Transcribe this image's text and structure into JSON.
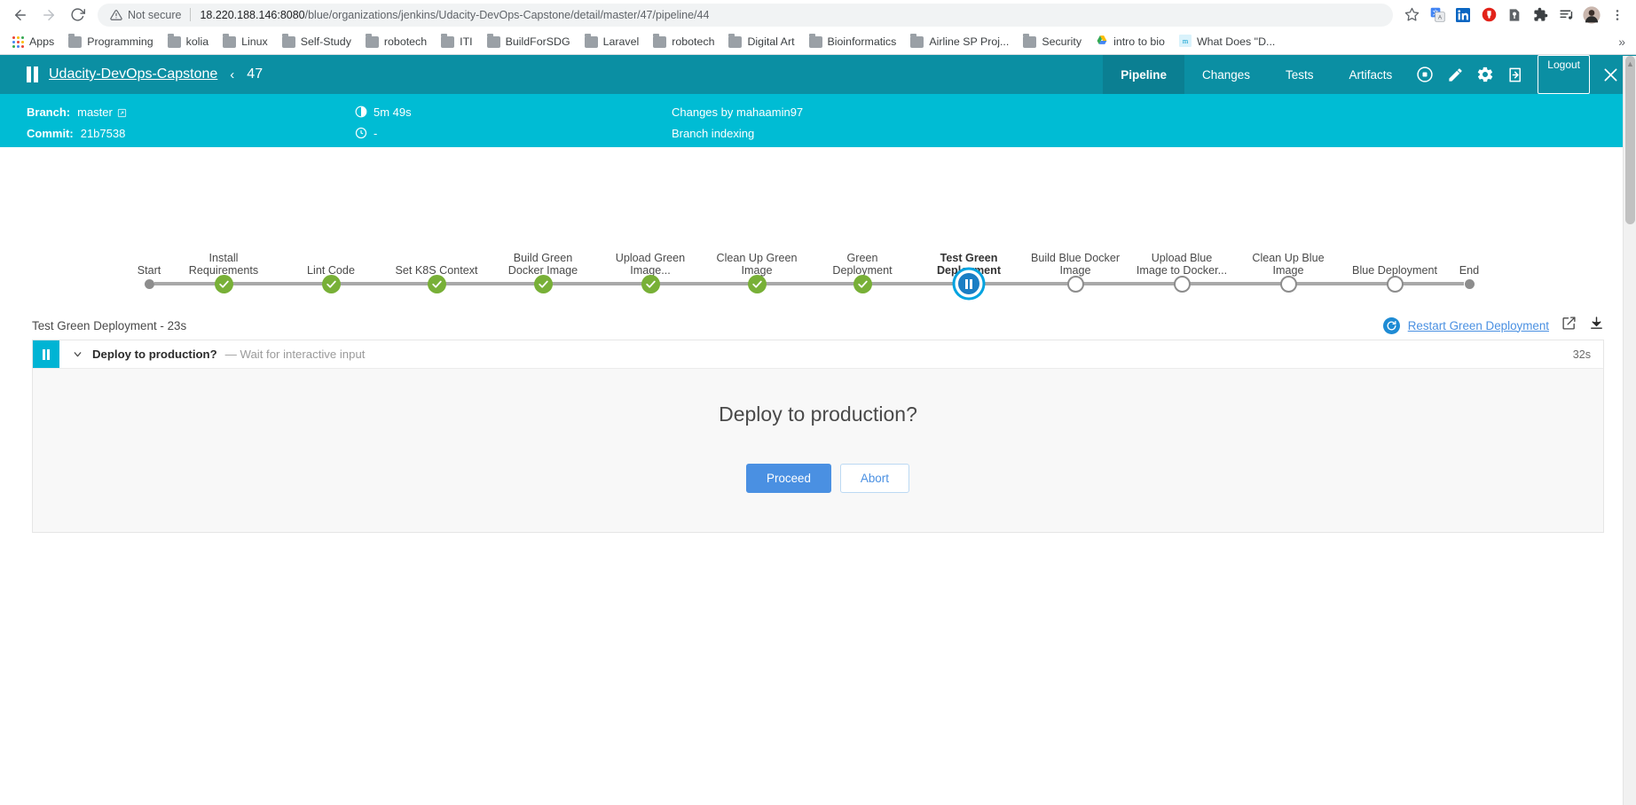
{
  "browser": {
    "back_icon": "back-arrow-icon",
    "forward_icon": "forward-arrow-icon",
    "reload_icon": "reload-icon",
    "security_label": "Not secure",
    "url_host": "18.220.188.146:8080",
    "url_path": "/blue/organizations/jenkins/Udacity-DevOps-Capstone/detail/master/47/pipeline/44",
    "toolbar_icons": [
      "bookmark-star-icon",
      "google-translate-icon",
      "linkedin-icon",
      "adblock-icon",
      "lastpass-icon",
      "extensions-puzzle-icon",
      "playlist-icon",
      "profile-avatar",
      "chrome-menu-icon"
    ],
    "bookmarks": [
      {
        "label": "Apps",
        "icon": "apps-grid-icon"
      },
      {
        "label": "Programming",
        "icon": "folder-icon"
      },
      {
        "label": "kolia",
        "icon": "folder-icon"
      },
      {
        "label": "Linux",
        "icon": "folder-icon"
      },
      {
        "label": "Self-Study",
        "icon": "folder-icon"
      },
      {
        "label": "robotech",
        "icon": "folder-icon"
      },
      {
        "label": "ITI",
        "icon": "folder-icon"
      },
      {
        "label": "BuildForSDG",
        "icon": "folder-icon"
      },
      {
        "label": "Laravel",
        "icon": "folder-icon"
      },
      {
        "label": "robotech",
        "icon": "folder-icon"
      },
      {
        "label": "Digital Art",
        "icon": "folder-icon"
      },
      {
        "label": "Bioinformatics",
        "icon": "folder-icon"
      },
      {
        "label": "Airline SP Proj...",
        "icon": "folder-icon"
      },
      {
        "label": "Security",
        "icon": "folder-icon"
      },
      {
        "label": "intro to bio",
        "icon": "drive-icon"
      },
      {
        "label": "What Does \"D...",
        "icon": "medium-icon"
      }
    ],
    "bookmarks_overflow": "»"
  },
  "app": {
    "status_icon": "pause-icon",
    "project_name": "Udacity-DevOps-Capstone",
    "separator": "‹",
    "run_number": "47",
    "nav_tabs": [
      {
        "label": "Pipeline",
        "active": true
      },
      {
        "label": "Changes",
        "active": false
      },
      {
        "label": "Tests",
        "active": false
      },
      {
        "label": "Artifacts",
        "active": false
      }
    ],
    "action_icons": [
      "stop-circle-icon",
      "edit-pencil-icon",
      "gear-icon",
      "logout-arrow-icon"
    ],
    "logout_label": "Logout",
    "close_icon": "close-x-icon",
    "meta": {
      "branch_label": "Branch:",
      "branch_value": "master",
      "branch_link_icon": "external-link-icon",
      "commit_label": "Commit:",
      "commit_value": "21b7538",
      "duration_icon": "duration-icon",
      "duration_value": "5m 49s",
      "time_icon": "clock-icon",
      "time_value": "-",
      "changes_by": "Changes by mahaamin97",
      "cause": "Branch indexing"
    },
    "colors": {
      "header_dark": "#0b8fa3",
      "header_active_tab": "#0b7f92",
      "subheader_cyan": "#00bcd4",
      "success_green": "#78b037",
      "paused_blue": "#1b7ec4",
      "paused_ring": "#00a3e0",
      "pending_gray": "#8d8d8d",
      "link_blue": "#4a90e2"
    }
  },
  "pipeline": {
    "stages": [
      {
        "label": "Start",
        "state": "terminal"
      },
      {
        "label": "Install\nRequirements",
        "state": "success"
      },
      {
        "label": "Lint Code",
        "state": "success"
      },
      {
        "label": "Set K8S Context",
        "state": "success"
      },
      {
        "label": "Build Green\nDocker Image",
        "state": "success"
      },
      {
        "label": "Upload Green\nImage...",
        "state": "success"
      },
      {
        "label": "Clean Up Green\nImage",
        "state": "success"
      },
      {
        "label": "Green\nDeployment",
        "state": "success"
      },
      {
        "label": "Test Green\nDeployment",
        "state": "paused"
      },
      {
        "label": "Build Blue Docker\nImage",
        "state": "pending"
      },
      {
        "label": "Upload Blue\nImage to Docker...",
        "state": "pending"
      },
      {
        "label": "Clean Up Blue\nImage",
        "state": "pending"
      },
      {
        "label": "Blue Deployment",
        "state": "pending"
      },
      {
        "label": "End",
        "state": "terminal"
      }
    ]
  },
  "log": {
    "section_title": "Test Green Deployment - 23s",
    "restart_label": "Restart Green Deployment",
    "restart_icon": "restart-circle-icon",
    "open_external_icon": "open-external-icon",
    "download_icon": "download-icon",
    "step": {
      "status_icon": "pause-icon",
      "chevron_icon": "chevron-down-icon",
      "title": "Deploy to production?",
      "subtitle": "— Wait for interactive input",
      "duration": "32s"
    },
    "input": {
      "question": "Deploy to production?",
      "proceed_label": "Proceed",
      "abort_label": "Abort"
    }
  }
}
